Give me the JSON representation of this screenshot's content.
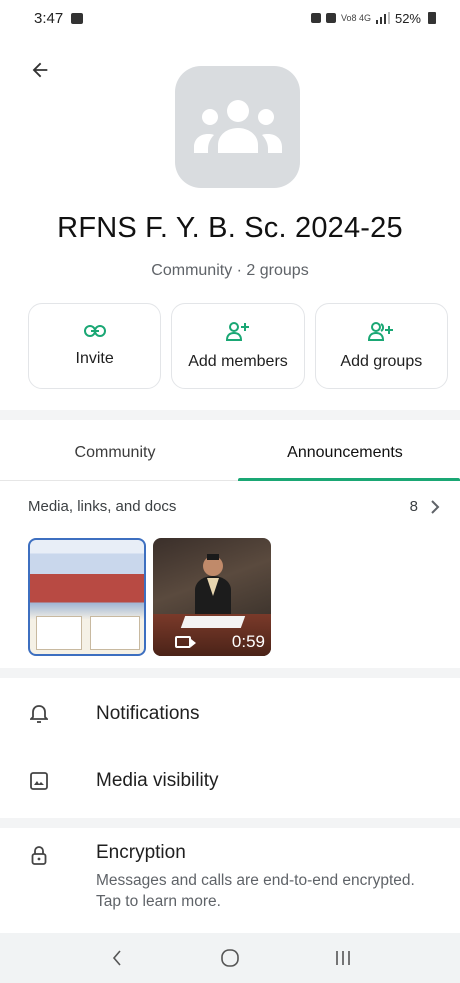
{
  "status_bar": {
    "time": "3:47",
    "network_text": "Vo8 4G",
    "battery": "52%"
  },
  "group": {
    "name": "RFNS F. Y. B. Sc. 2024-25",
    "subtitle": "Community · 2 groups"
  },
  "actions": [
    {
      "label": "Invite",
      "icon": "link-icon"
    },
    {
      "label": "Add members",
      "icon": "add-person-icon"
    },
    {
      "label": "Add groups",
      "icon": "add-group-icon"
    }
  ],
  "tabs": [
    {
      "label": "Community",
      "active": false
    },
    {
      "label": "Announcements",
      "active": true
    }
  ],
  "media": {
    "label": "Media, links, and docs",
    "count": "8",
    "video_duration": "0:59"
  },
  "settings": {
    "notifications": "Notifications",
    "media_visibility": "Media visibility",
    "encryption_title": "Encryption",
    "encryption_desc": "Messages and calls are end-to-end encrypted. Tap to learn more."
  },
  "colors": {
    "accent": "#1aa774",
    "avatar_bg": "#d9dcdf",
    "nav_bg": "#f1f3f4"
  }
}
